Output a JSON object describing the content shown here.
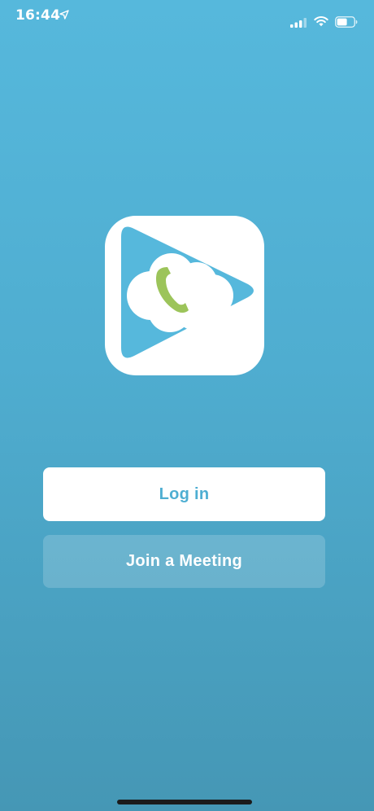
{
  "status_bar": {
    "time": "16:44",
    "icons": [
      "location-arrow-icon",
      "cellular-signal-icon",
      "wifi-icon",
      "battery-icon"
    ]
  },
  "logo": {
    "icon": "app-logo-icon",
    "colors": {
      "background": "#ffffff",
      "triangle": "#56b8dc",
      "cloud": "#ffffff",
      "phone": "#9cc45a"
    }
  },
  "buttons": {
    "login_label": "Log in",
    "join_label": "Join a Meeting"
  },
  "colors": {
    "background_top": "#56b8dc",
    "background_bottom": "#4597b5",
    "login_text": "#4eaed2"
  }
}
